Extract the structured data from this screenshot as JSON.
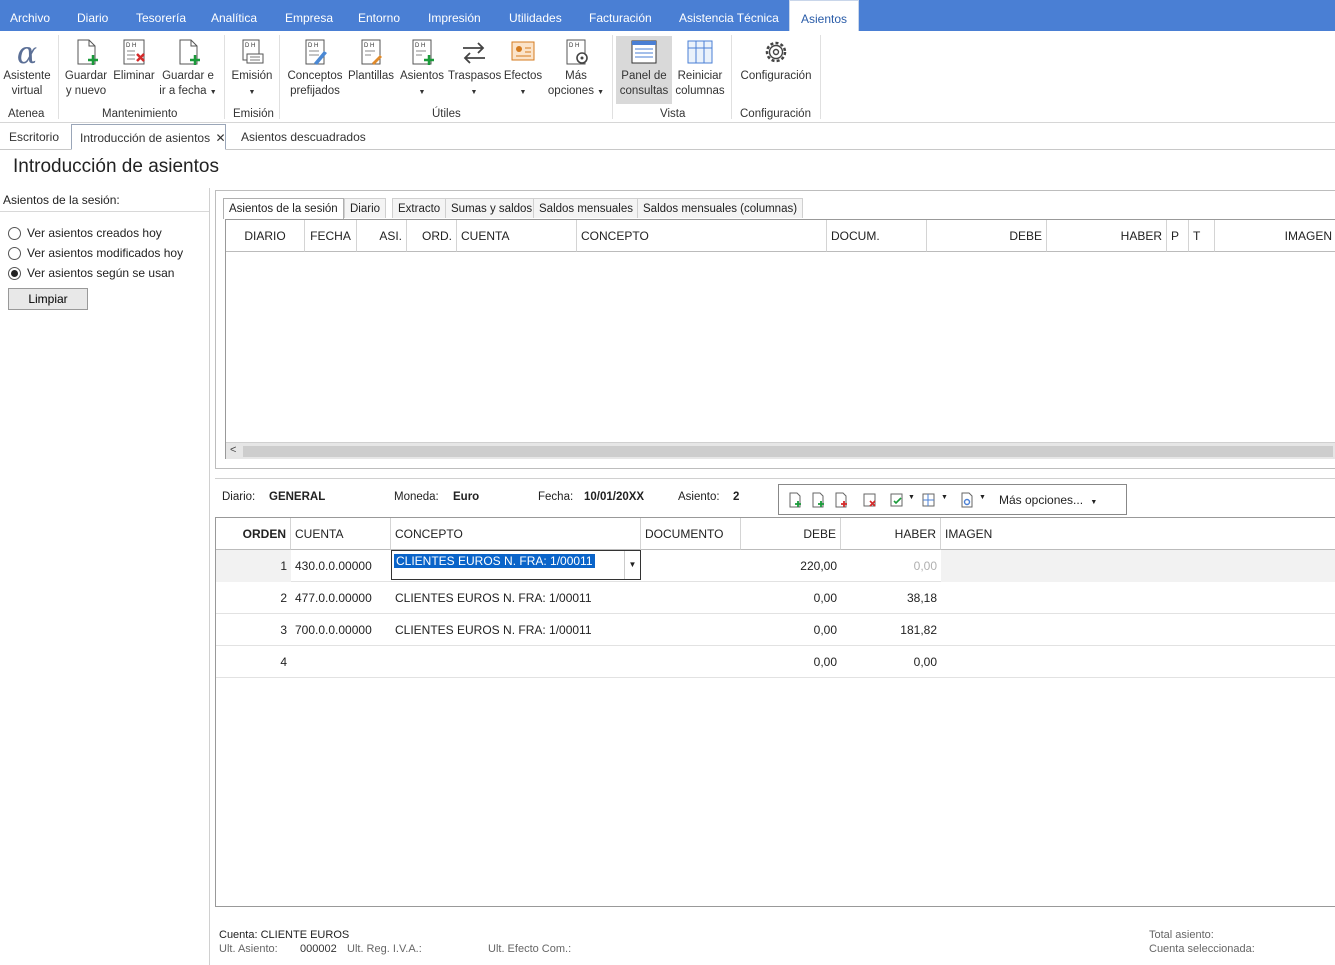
{
  "menu": {
    "items": [
      "Archivo",
      "Diario",
      "Tesorería",
      "Analítica",
      "Empresa",
      "Entorno",
      "Impresión",
      "Utilidades",
      "Facturación",
      "Asistencia Técnica",
      "Asientos"
    ]
  },
  "ribbon": {
    "asistente": [
      "Asistente",
      "virtual"
    ],
    "guardar_nuevo": [
      "Guardar",
      "y nuevo"
    ],
    "eliminar": "Eliminar",
    "guardar_fecha": [
      "Guardar e",
      "ir a fecha"
    ],
    "emision": "Emisión",
    "conceptos": [
      "Conceptos",
      "prefijados"
    ],
    "plantillas": "Plantillas",
    "asientos": "Asientos",
    "traspasos": "Traspasos",
    "efectos": "Efectos",
    "mas_opciones": [
      "Más",
      "opciones"
    ],
    "panel": [
      "Panel de",
      "consultas"
    ],
    "reiniciar": [
      "Reiniciar",
      "columnas"
    ],
    "configuracion": "Configuración",
    "groups": {
      "atenea": "Atenea",
      "mantenimiento": "Mantenimiento",
      "emision": "Emisión",
      "utiles": "Útiles",
      "vista": "Vista",
      "configuracion": "Configuración"
    }
  },
  "doc_tabs": {
    "escritorio": "Escritorio",
    "introduccion": "Introducción de asientos",
    "descuadrados": "Asientos descuadrados",
    "close": "✕"
  },
  "page_title": "Introducción de asientos",
  "left": {
    "title": "Asientos de la sesión:",
    "options": [
      "Ver asientos creados hoy",
      "Ver asientos modificados hoy",
      "Ver asientos según se usan"
    ],
    "selected": 2,
    "clear_button": "Limpiar"
  },
  "inner_tabs": [
    "Asientos de la sesión",
    "Diario",
    "Extracto",
    "Sumas y saldos",
    "Saldos mensuales",
    "Saldos mensuales (columnas)"
  ],
  "grid1_headers": [
    "DIARIO",
    "FECHA",
    "ASI.",
    "ORD.",
    "CUENTA",
    "CONCEPTO",
    "DOCUM.",
    "DEBE",
    "HABER",
    "P",
    "T",
    "IMAGEN"
  ],
  "info": {
    "diario_label": "Diario:",
    "diario": "GENERAL",
    "moneda_label": "Moneda:",
    "moneda": "Euro",
    "fecha_label": "Fecha:",
    "fecha": "10/01/20XX",
    "asiento_label": "Asiento:",
    "asiento": "2",
    "mas_opciones": "Más opciones..."
  },
  "grid2": {
    "headers": [
      "ORDEN",
      "CUENTA",
      "CONCEPTO",
      "DOCUMENTO",
      "DEBE",
      "HABER",
      "IMAGEN"
    ],
    "rows": [
      {
        "orden": "1",
        "cuenta": "430.0.0.00000",
        "concepto": "CLIENTES EUROS N. FRA:  1/00011",
        "documento": "",
        "debe": "220,00",
        "haber": "0,00"
      },
      {
        "orden": "2",
        "cuenta": "477.0.0.00000",
        "concepto": "CLIENTES EUROS N. FRA:  1/00011",
        "documento": "",
        "debe": "0,00",
        "haber": "38,18"
      },
      {
        "orden": "3",
        "cuenta": "700.0.0.00000",
        "concepto": "CLIENTES EUROS N. FRA:  1/00011",
        "documento": "",
        "debe": "0,00",
        "haber": "181,82"
      },
      {
        "orden": "4",
        "cuenta": "",
        "concepto": "",
        "documento": "",
        "debe": "0,00",
        "haber": "0,00"
      }
    ]
  },
  "footer": {
    "cuenta": "Cuenta: CLIENTE EUROS",
    "ult_asiento_label": "Ult. Asiento:",
    "ult_asiento": "000002",
    "ult_iva_label": "Ult. Reg. I.V.A.:",
    "ult_efecto_label": "Ult. Efecto Com.:",
    "total_asiento": "Total asiento:",
    "cuenta_sel": "Cuenta seleccionada:"
  }
}
